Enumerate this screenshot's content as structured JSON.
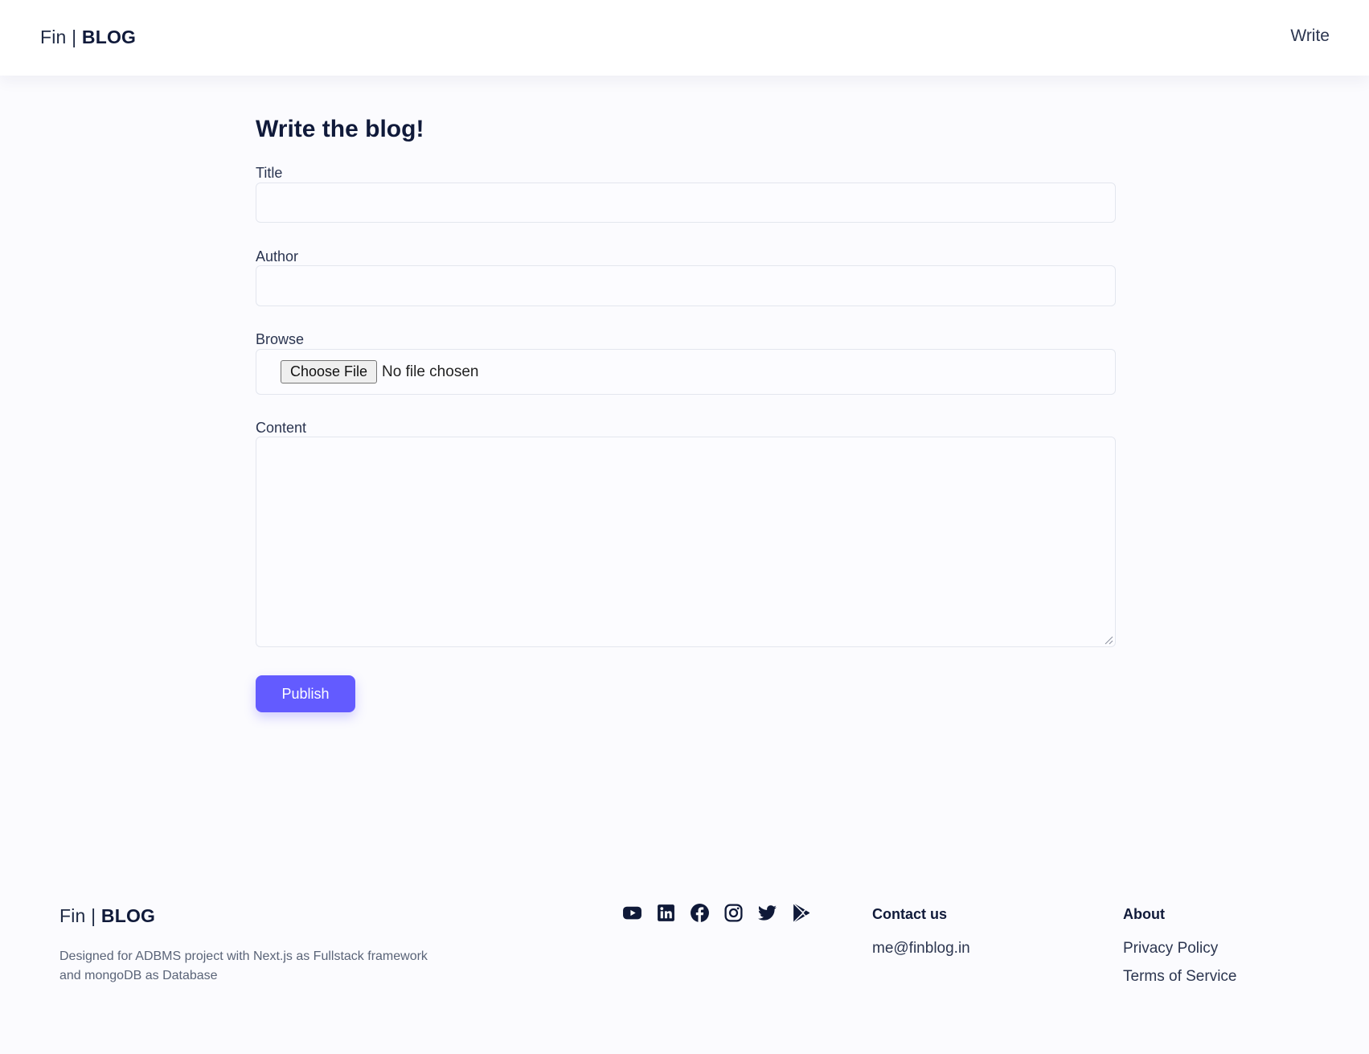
{
  "header": {
    "logo_prefix": "Fin | ",
    "logo_brand": "BLOG",
    "nav_write": "Write"
  },
  "form": {
    "heading": "Write the blog!",
    "title_label": "Title",
    "title_value": "",
    "author_label": "Author",
    "author_value": "",
    "browse_label": "Browse",
    "choose_file_label": "Choose File",
    "file_status": "No file chosen",
    "content_label": "Content",
    "content_value": "",
    "publish_label": "Publish"
  },
  "footer": {
    "logo_prefix": "Fin | ",
    "logo_brand": "BLOG",
    "description": "Designed for ADBMS project with Next.js as Fullstack framework and mongoDB as Database",
    "socials": [
      "youtube-icon",
      "linkedin-icon",
      "facebook-icon",
      "instagram-icon",
      "twitter-icon",
      "play-store-icon"
    ],
    "contact_heading": "Contact us",
    "contact_email": "me@finblog.in",
    "about_heading": "About",
    "privacy_policy": "Privacy Policy",
    "terms_of_service": "Terms of Service"
  },
  "colors": {
    "accent": "#635bff",
    "background": "#fbfbfe",
    "heading_text": "#101a3a"
  }
}
